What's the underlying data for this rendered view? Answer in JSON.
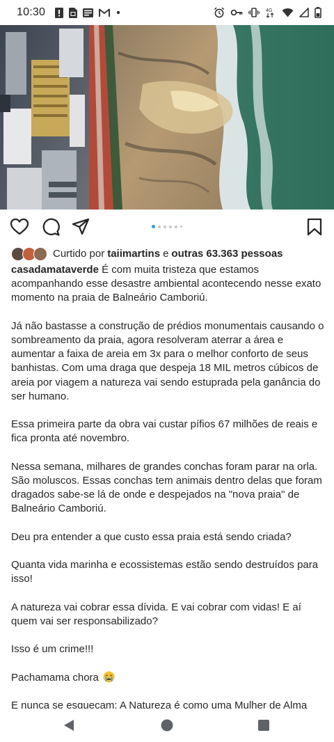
{
  "status_bar": {
    "time": "10:30",
    "left_icons": [
      "notification-alert-icon",
      "sim-card-icon",
      "news-icon",
      "gmail-icon",
      "more-dot-icon"
    ],
    "right_icons": [
      "alarm-icon",
      "vpn-key-icon",
      "vibrate-icon",
      "4g-signal-icon",
      "wifi-icon",
      "cell-signal-icon",
      "battery-icon"
    ],
    "network_label": "4G"
  },
  "post": {
    "image_alt_icon": "aerial-beach-photo",
    "carousel": {
      "count": 6,
      "active_index": 0
    },
    "actions": {
      "like_icon": "heart-icon",
      "comment_icon": "comment-icon",
      "share_icon": "send-icon",
      "save_icon": "bookmark-icon"
    },
    "likes": {
      "prefix": "Curtido por",
      "user": "taiimartins",
      "connector": "e",
      "others": "outras 63.363 pessoas"
    },
    "caption": {
      "author": "casadamataverde",
      "paragraphs": [
        "É com muita tristeza que estamos acompanhando esse desastre ambiental acontecendo nesse exato momento na praia de Balneário Camboriú.",
        "Já não bastasse a construção de prédios monumentais causando o sombreamento da praia, agora resolveram aterrar a área e aumentar a faixa de areia em 3x para o melhor conforto de seus banhistas. Com uma draga que despeja 18 MIL metros cúbicos de areia por viagem a natureza vai sendo estuprada pela ganância do ser humano.",
        "Essa primeira parte da obra vai custar pífios 67 milhões de reais e fica pronta até novembro.",
        "Nessa semana, milhares de grandes conchas foram parar na orla. São moluscos. Essas conchas tem animais dentro delas que foram dragados sabe-se lá de onde e despejados na \"nova praia\" de Balneário Camboriú.",
        "Deu pra entender a que custo essa praia está sendo criada?",
        "Quanta vida marinha e ecossistemas estão sendo destruídos para isso!",
        "A natureza vai cobrar essa dívida. E vai cobrar com vidas! E aí quem vai ser responsabilizado?",
        "Isso é um crime!!!",
        "Pachamama chora",
        "E nunca se esqueçam: A Natureza é como uma Mulher de Alma Livre. Ela é indomável!"
      ],
      "emoji_icon": "crying-face-icon"
    }
  },
  "nav_bar": {
    "back_icon": "back-triangle-icon",
    "home_icon": "home-circle-icon",
    "recents_icon": "recents-square-icon"
  },
  "colors": {
    "text": "#262626",
    "carousel_active": "#3897f0",
    "carousel_inactive": "#c7c7c7",
    "nav_icons": "#5f6368"
  }
}
